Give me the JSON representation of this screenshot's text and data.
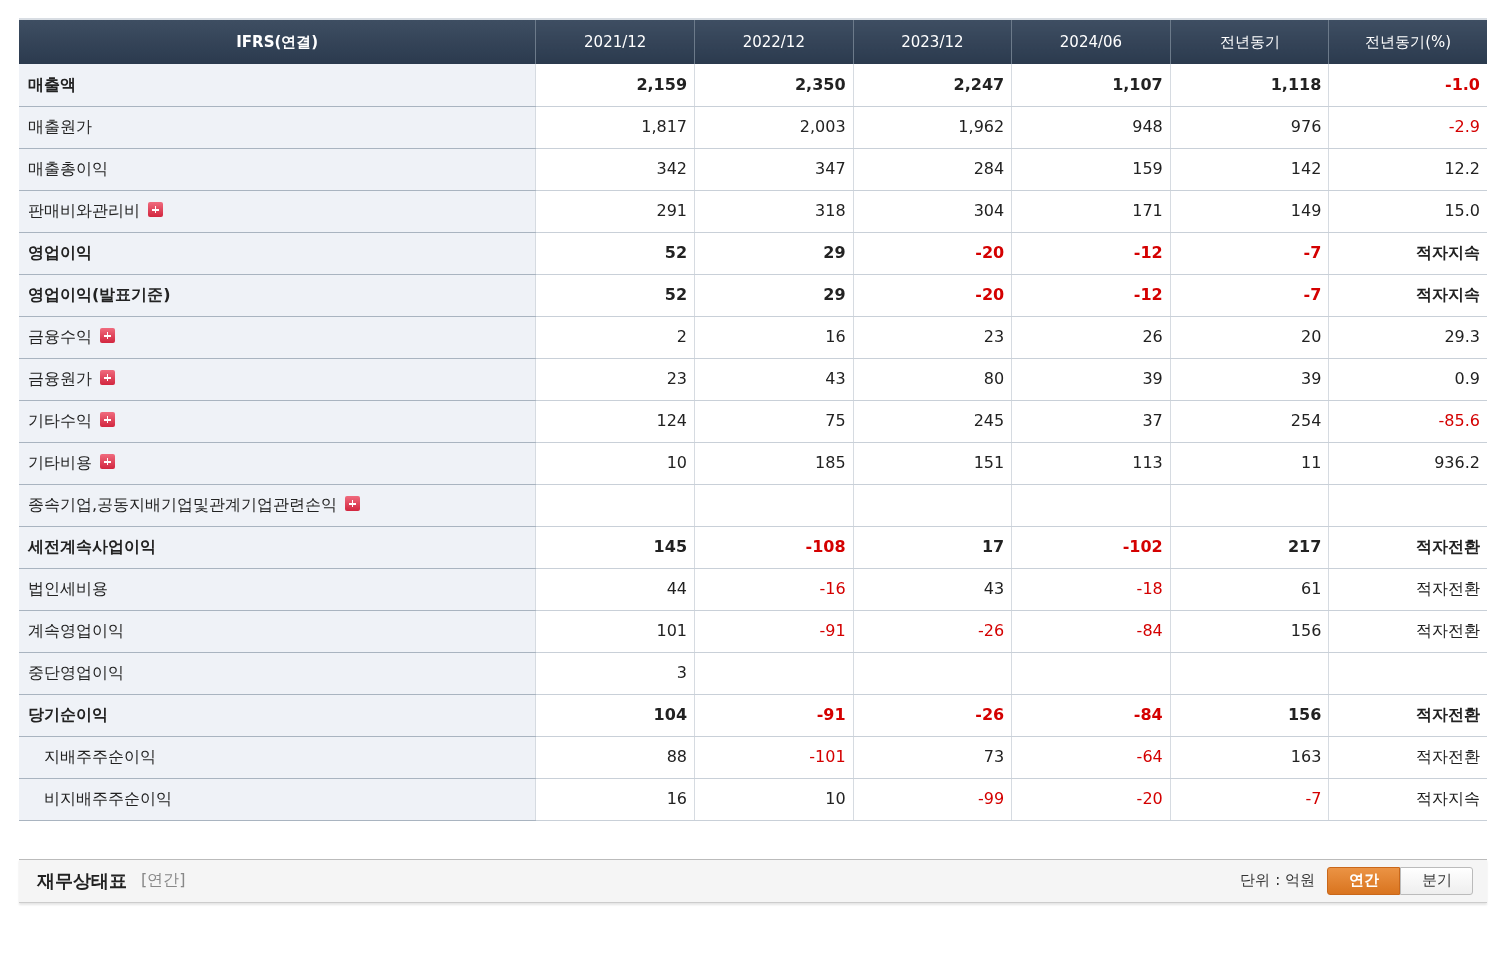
{
  "table": {
    "label_column": "IFRS(연결)",
    "columns": [
      "2021/12",
      "2022/12",
      "2023/12",
      "2024/06",
      "전년동기",
      "전년동기(%)"
    ],
    "rows": [
      {
        "label": "매출액",
        "bold": true,
        "expandable": false,
        "cells": [
          {
            "text": "2,159",
            "negative": false
          },
          {
            "text": "2,350",
            "negative": false
          },
          {
            "text": "2,247",
            "negative": false
          },
          {
            "text": "1,107",
            "negative": false
          },
          {
            "text": "1,118",
            "negative": false
          },
          {
            "text": "-1.0",
            "negative": true
          }
        ]
      },
      {
        "label": "매출원가",
        "bold": false,
        "expandable": false,
        "cells": [
          {
            "text": "1,817",
            "negative": false
          },
          {
            "text": "2,003",
            "negative": false
          },
          {
            "text": "1,962",
            "negative": false
          },
          {
            "text": "948",
            "negative": false
          },
          {
            "text": "976",
            "negative": false
          },
          {
            "text": "-2.9",
            "negative": true
          }
        ]
      },
      {
        "label": "매출총이익",
        "bold": false,
        "expandable": false,
        "cells": [
          {
            "text": "342",
            "negative": false
          },
          {
            "text": "347",
            "negative": false
          },
          {
            "text": "284",
            "negative": false
          },
          {
            "text": "159",
            "negative": false
          },
          {
            "text": "142",
            "negative": false
          },
          {
            "text": "12.2",
            "negative": false
          }
        ]
      },
      {
        "label": "판매비와관리비",
        "bold": false,
        "expandable": true,
        "cells": [
          {
            "text": "291",
            "negative": false
          },
          {
            "text": "318",
            "negative": false
          },
          {
            "text": "304",
            "negative": false
          },
          {
            "text": "171",
            "negative": false
          },
          {
            "text": "149",
            "negative": false
          },
          {
            "text": "15.0",
            "negative": false
          }
        ]
      },
      {
        "label": "영업이익",
        "bold": true,
        "expandable": false,
        "cells": [
          {
            "text": "52",
            "negative": false
          },
          {
            "text": "29",
            "negative": false
          },
          {
            "text": "-20",
            "negative": true
          },
          {
            "text": "-12",
            "negative": true
          },
          {
            "text": "-7",
            "negative": true
          },
          {
            "text": "적자지속",
            "negative": false
          }
        ]
      },
      {
        "label": "영업이익(발표기준)",
        "bold": true,
        "expandable": false,
        "cells": [
          {
            "text": "52",
            "negative": false
          },
          {
            "text": "29",
            "negative": false
          },
          {
            "text": "-20",
            "negative": true
          },
          {
            "text": "-12",
            "negative": true
          },
          {
            "text": "-7",
            "negative": true
          },
          {
            "text": "적자지속",
            "negative": false
          }
        ]
      },
      {
        "label": "금융수익",
        "bold": false,
        "expandable": true,
        "cells": [
          {
            "text": "2",
            "negative": false
          },
          {
            "text": "16",
            "negative": false
          },
          {
            "text": "23",
            "negative": false
          },
          {
            "text": "26",
            "negative": false
          },
          {
            "text": "20",
            "negative": false
          },
          {
            "text": "29.3",
            "negative": false
          }
        ]
      },
      {
        "label": "금융원가",
        "bold": false,
        "expandable": true,
        "cells": [
          {
            "text": "23",
            "negative": false
          },
          {
            "text": "43",
            "negative": false
          },
          {
            "text": "80",
            "negative": false
          },
          {
            "text": "39",
            "negative": false
          },
          {
            "text": "39",
            "negative": false
          },
          {
            "text": "0.9",
            "negative": false
          }
        ]
      },
      {
        "label": "기타수익",
        "bold": false,
        "expandable": true,
        "cells": [
          {
            "text": "124",
            "negative": false
          },
          {
            "text": "75",
            "negative": false
          },
          {
            "text": "245",
            "negative": false
          },
          {
            "text": "37",
            "negative": false
          },
          {
            "text": "254",
            "negative": false
          },
          {
            "text": "-85.6",
            "negative": true
          }
        ]
      },
      {
        "label": "기타비용",
        "bold": false,
        "expandable": true,
        "cells": [
          {
            "text": "10",
            "negative": false
          },
          {
            "text": "185",
            "negative": false
          },
          {
            "text": "151",
            "negative": false
          },
          {
            "text": "113",
            "negative": false
          },
          {
            "text": "11",
            "negative": false
          },
          {
            "text": "936.2",
            "negative": false
          }
        ]
      },
      {
        "label": "종속기업,공동지배기업및관계기업관련손익",
        "bold": false,
        "expandable": true,
        "cells": [
          null,
          null,
          null,
          null,
          null,
          null
        ]
      },
      {
        "label": "세전계속사업이익",
        "bold": true,
        "expandable": false,
        "cells": [
          {
            "text": "145",
            "negative": false
          },
          {
            "text": "-108",
            "negative": true
          },
          {
            "text": "17",
            "negative": false
          },
          {
            "text": "-102",
            "negative": true
          },
          {
            "text": "217",
            "negative": false
          },
          {
            "text": "적자전환",
            "negative": false
          }
        ]
      },
      {
        "label": "법인세비용",
        "bold": false,
        "expandable": false,
        "cells": [
          {
            "text": "44",
            "negative": false
          },
          {
            "text": "-16",
            "negative": true
          },
          {
            "text": "43",
            "negative": false
          },
          {
            "text": "-18",
            "negative": true
          },
          {
            "text": "61",
            "negative": false
          },
          {
            "text": "적자전환",
            "negative": false
          }
        ]
      },
      {
        "label": "계속영업이익",
        "bold": false,
        "expandable": false,
        "cells": [
          {
            "text": "101",
            "negative": false
          },
          {
            "text": "-91",
            "negative": true
          },
          {
            "text": "-26",
            "negative": true
          },
          {
            "text": "-84",
            "negative": true
          },
          {
            "text": "156",
            "negative": false
          },
          {
            "text": "적자전환",
            "negative": false
          }
        ]
      },
      {
        "label": "중단영업이익",
        "bold": false,
        "expandable": false,
        "cells": [
          {
            "text": "3",
            "negative": false
          },
          null,
          null,
          null,
          null,
          null
        ]
      },
      {
        "label": "당기순이익",
        "bold": true,
        "expandable": false,
        "cells": [
          {
            "text": "104",
            "negative": false
          },
          {
            "text": "-91",
            "negative": true
          },
          {
            "text": "-26",
            "negative": true
          },
          {
            "text": "-84",
            "negative": true
          },
          {
            "text": "156",
            "negative": false
          },
          {
            "text": "적자전환",
            "negative": false
          }
        ],
        "children": [
          {
            "label": "지배주주순이익",
            "bold": false,
            "expandable": false,
            "cells": [
              {
                "text": "88",
                "negative": false
              },
              {
                "text": "-101",
                "negative": true
              },
              {
                "text": "73",
                "negative": false
              },
              {
                "text": "-64",
                "negative": true
              },
              {
                "text": "163",
                "negative": false
              },
              {
                "text": "적자전환",
                "negative": false
              }
            ]
          },
          {
            "label": "비지배주주순이익",
            "bold": false,
            "expandable": false,
            "cells": [
              {
                "text": "16",
                "negative": false
              },
              {
                "text": "10",
                "negative": false
              },
              {
                "text": "-99",
                "negative": true
              },
              {
                "text": "-20",
                "negative": true
              },
              {
                "text": "-7",
                "negative": true
              },
              {
                "text": "적자지속",
                "negative": false
              }
            ]
          }
        ]
      }
    ]
  },
  "next_section": {
    "title": "재무상태표",
    "period": "[연간]",
    "unit": "단위 : 억원",
    "toggles": [
      {
        "label": "연간",
        "selected": true
      },
      {
        "label": "분기",
        "selected": false
      }
    ]
  }
}
